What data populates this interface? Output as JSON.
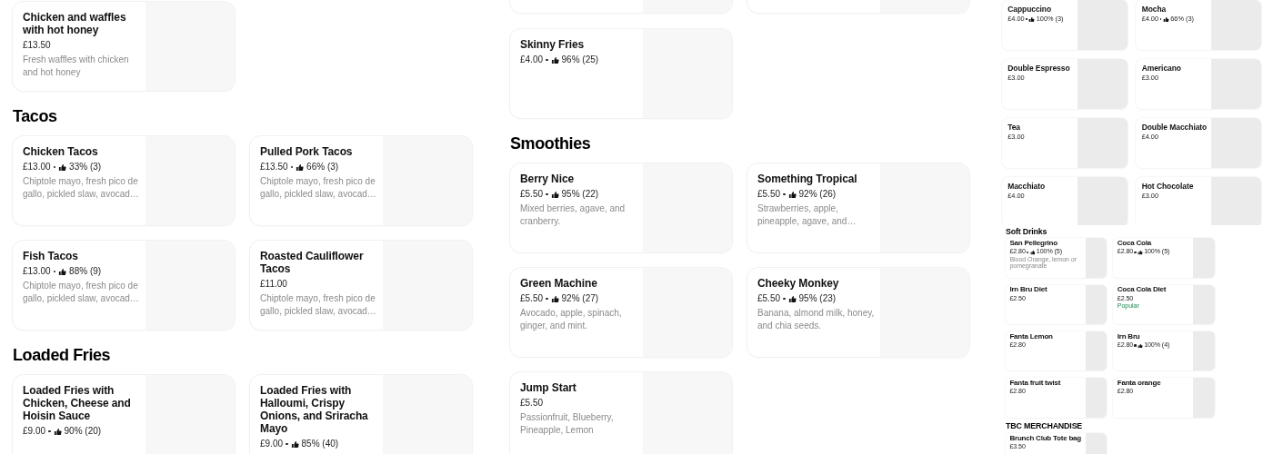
{
  "screens": [
    {
      "sections": [
        {
          "items": [
            {
              "kind": "item",
              "name": "Chicken and waffles with hot honey",
              "price": "£13.50",
              "description": "Fresh waffles with chicken and hot honey"
            }
          ]
        },
        {
          "heading": "Tacos",
          "items": [
            {
              "kind": "item",
              "name": "Chicken Tacos",
              "price": "£13.00",
              "rating": "33% (3)",
              "description": "Chiptole mayo, fresh pico de gallo, pickled slaw, avocad…"
            },
            {
              "kind": "item",
              "name": "Pulled Pork Tacos",
              "price": "£13.50",
              "rating": "66% (3)",
              "description": "Chiptole mayo, fresh pico de gallo, pickled slaw, avocad…"
            },
            {
              "kind": "item",
              "name": "Fish Tacos",
              "price": "£13.00",
              "rating": "88% (9)",
              "description": "Chiptole mayo, fresh pico de gallo, pickled slaw, avocad…"
            },
            {
              "kind": "item",
              "name": "Roasted Cauliflower Tacos",
              "price": "£11.00",
              "description": "Chiptole mayo, fresh pico de gallo, pickled slaw, avocad…"
            }
          ]
        },
        {
          "heading": "Loaded Fries",
          "items": [
            {
              "kind": "item",
              "name": "Loaded Fries with Chicken, Cheese and Hoisin Sauce",
              "price": "£9.00",
              "rating": "90% (20)"
            },
            {
              "kind": "item",
              "name": "Loaded Fries with Halloumi, Crispy Onions, and Sriracha Mayo",
              "price": "£9.00",
              "rating": "85% (40)"
            }
          ]
        }
      ]
    },
    {
      "sections": [
        {
          "items": [
            {
              "kind": "stub"
            },
            {
              "kind": "stub"
            },
            {
              "kind": "item",
              "name": "Skinny Fries",
              "price": "£4.00",
              "rating": "96% (25)"
            }
          ]
        },
        {
          "heading": "Smoothies",
          "items": [
            {
              "kind": "item",
              "name": "Berry Nice",
              "price": "£5.50",
              "rating": "95% (22)",
              "description": "Mixed berries, agave, and cranberry."
            },
            {
              "kind": "item",
              "name": "Something Tropical",
              "price": "£5.50",
              "rating": "92% (26)",
              "description": "Strawberries, apple, pineapple, agave, and…"
            },
            {
              "kind": "item",
              "name": "Green Machine",
              "price": "£5.50",
              "rating": "92% (27)",
              "description": "Avocado, apple, spinach, ginger, and mint."
            },
            {
              "kind": "item",
              "name": "Cheeky Monkey",
              "price": "£5.50",
              "rating": "95% (23)",
              "description": "Banana, almond milk, honey, and chia seeds."
            },
            {
              "kind": "item",
              "name": "Jump Start",
              "price": "£5.50",
              "description": "Passionfruit, Blueberry, Pineapple, Lemon"
            }
          ]
        }
      ]
    },
    {
      "sections": [
        {
          "items": [
            {
              "kind": "item",
              "name": "Cappuccino",
              "price": "£4.00",
              "rating": "100% (3)"
            },
            {
              "kind": "item",
              "name": "Mocha",
              "price": "£4.00",
              "rating": "66% (3)"
            },
            {
              "kind": "item",
              "name": "Double Espresso",
              "price": "£3.00"
            },
            {
              "kind": "item",
              "name": "Americano",
              "price": "£3.00"
            },
            {
              "kind": "item",
              "name": "Tea",
              "price": "£3.00"
            },
            {
              "kind": "item",
              "name": "Double Macchiato",
              "price": "£4.00"
            },
            {
              "kind": "item",
              "name": "Macchiato",
              "price": "£4.00"
            },
            {
              "kind": "item",
              "name": "Hot Chocolate",
              "price": "£3.00"
            }
          ]
        }
      ]
    },
    {
      "sections": [
        {
          "heading": "Soft Drinks",
          "items": [
            {
              "kind": "item",
              "name": "San Pellegrino",
              "price": "£2.80",
              "rating": "100% (5)",
              "description": "Blood Orange, lemon or pomegranate"
            },
            {
              "kind": "item",
              "name": "Coca Cola",
              "price": "£2.80",
              "rating": "100% (5)"
            },
            {
              "kind": "item",
              "name": "Irn Bru Diet",
              "price": "£2.50"
            },
            {
              "kind": "item",
              "name": "Coca Cola Diet",
              "price": "£2.50",
              "badge": "Popular"
            },
            {
              "kind": "item",
              "name": "Fanta Lemon",
              "price": "£2.80"
            },
            {
              "kind": "item",
              "name": "Irn Bru",
              "price": "£2.80",
              "rating": "100% (4)"
            },
            {
              "kind": "item",
              "name": "Fanta fruit twist",
              "price": "£2.80"
            },
            {
              "kind": "item",
              "name": "Fanta orange",
              "price": "£2.80"
            }
          ]
        },
        {
          "heading": "TBC MERCHANDISE",
          "items": [
            {
              "kind": "item",
              "name": "Brunch Club Tote bag",
              "price": "£3.50"
            }
          ]
        }
      ]
    }
  ]
}
